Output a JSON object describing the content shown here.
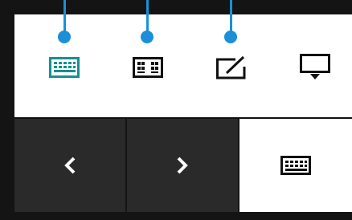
{
  "toolbar": {
    "items": [
      {
        "icon": "keyboard-icon",
        "active": true,
        "color": "#178f8f"
      },
      {
        "icon": "split-keyboard-icon",
        "active": false,
        "color": "#111111"
      },
      {
        "icon": "handwriting-panel-icon",
        "active": false,
        "color": "#111111"
      },
      {
        "icon": "dock-keyboard-icon",
        "active": false,
        "color": "#111111"
      }
    ]
  },
  "callout_color": "#1b8fd8",
  "navbar": {
    "buttons": [
      {
        "icon": "chevron-left-icon"
      },
      {
        "icon": "chevron-right-icon"
      },
      {
        "icon": "keyboard-icon",
        "active": true
      }
    ]
  }
}
